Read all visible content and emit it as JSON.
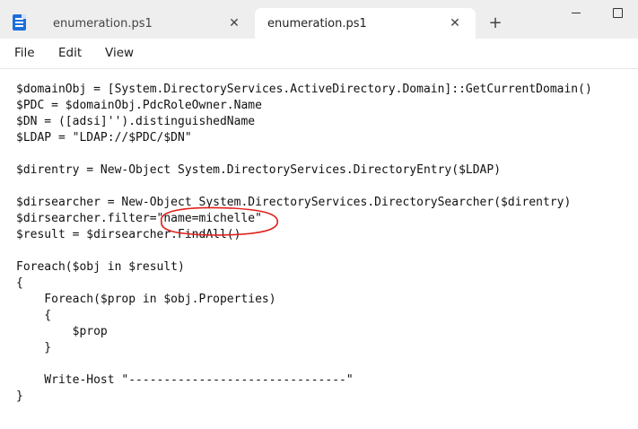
{
  "tabs": [
    {
      "title": "enumeration.ps1",
      "active": false,
      "close_glyph": "✕"
    },
    {
      "title": "enumeration.ps1",
      "active": true,
      "close_glyph": "✕"
    }
  ],
  "new_tab_glyph": "+",
  "menu": [
    "File",
    "Edit",
    "View"
  ],
  "code_lines": [
    "$domainObj = [System.DirectoryServices.ActiveDirectory.Domain]::GetCurrentDomain()",
    "$PDC = $domainObj.PdcRoleOwner.Name",
    "$DN = ([adsi]'').distinguishedName",
    "$LDAP = \"LDAP://$PDC/$DN\"",
    "",
    "$direntry = New-Object System.DirectoryServices.DirectoryEntry($LDAP)",
    "",
    "$dirsearcher = New-Object System.DirectoryServices.DirectorySearcher($direntry)",
    "$dirsearcher.filter=\"name=michelle\"",
    "$result = $dirsearcher.FindAll()",
    "",
    "Foreach($obj in $result)",
    "{",
    "    Foreach($prop in $obj.Properties)",
    "    {",
    "        $prop",
    "    }",
    "",
    "    Write-Host \"-------------------------------\"",
    "}"
  ],
  "colors": {
    "titlebar": "#eeeeee",
    "annotation": "#e0201b",
    "accent": "#1e6fd9"
  },
  "icons": [
    "notepad-icon",
    "close-icon",
    "plus-icon",
    "minimize-icon",
    "maximize-icon"
  ]
}
